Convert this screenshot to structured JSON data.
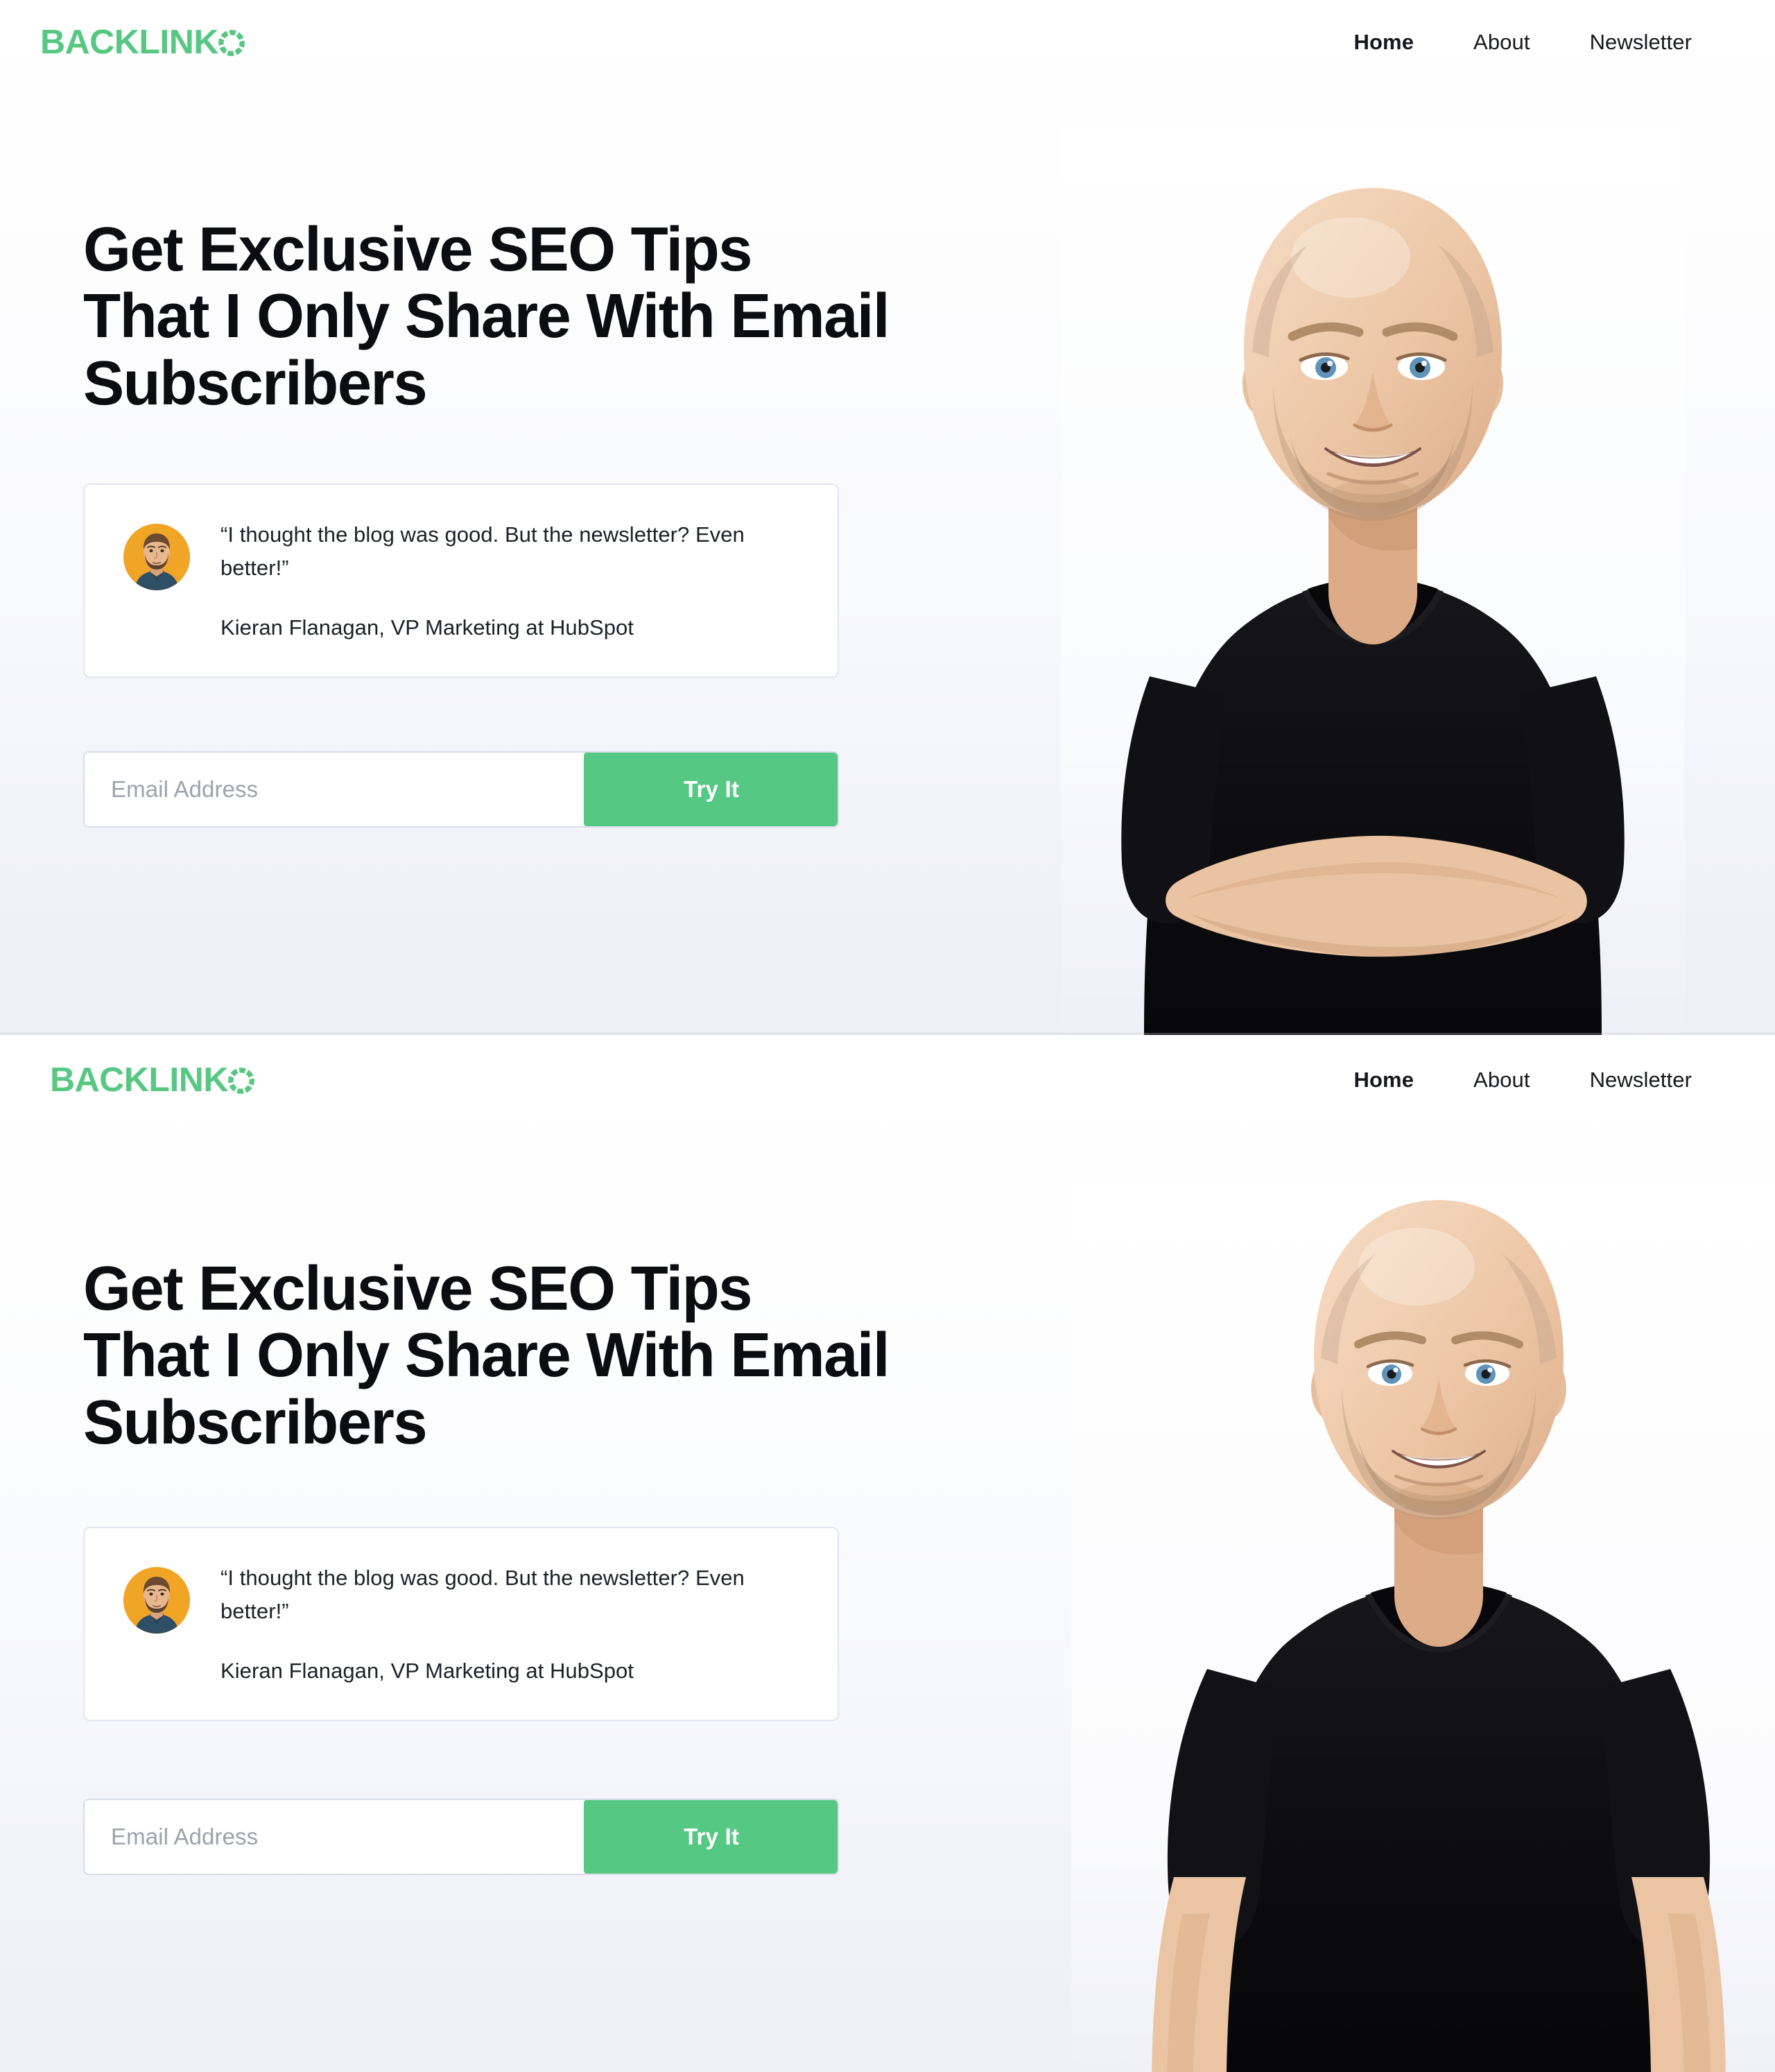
{
  "brand": {
    "logo_text": "BACKLINK",
    "logo_ring_icon": "segmented-ring-o-icon",
    "logo_color": "#57c782"
  },
  "nav": {
    "items": [
      {
        "label": "Home",
        "active": true
      },
      {
        "label": "About",
        "active": false
      },
      {
        "label": "Newsletter",
        "active": false
      }
    ]
  },
  "hero": {
    "title": "Get Exclusive SEO Tips That I Only Share With Email Subscribers",
    "portrait_alt": "Bald smiling man in black t-shirt with arms crossed"
  },
  "hero_two": {
    "title": "Get Exclusive SEO Tips That I Only Share With Email Subscribers",
    "portrait_alt": "Bald smiling man in black t-shirt standing"
  },
  "testimonial": {
    "quote": "“I thought the blog was good. But the newsletter? Even better!”",
    "author": "Kieran Flanagan, VP Marketing at HubSpot",
    "avatar_icon": "avatar-portrait-icon",
    "avatar_bg": "#f0a526"
  },
  "signup": {
    "email_placeholder": "Email Address",
    "email_value": "",
    "submit_label": "Try It",
    "accent_color": "#55c983"
  },
  "theme": {
    "page_bg_top": "#ffffff",
    "page_bg_bottom": "#eeeff7",
    "text_color": "#0c0d10",
    "card_border": "#e3e6ef",
    "input_border": "#d8dce8"
  }
}
